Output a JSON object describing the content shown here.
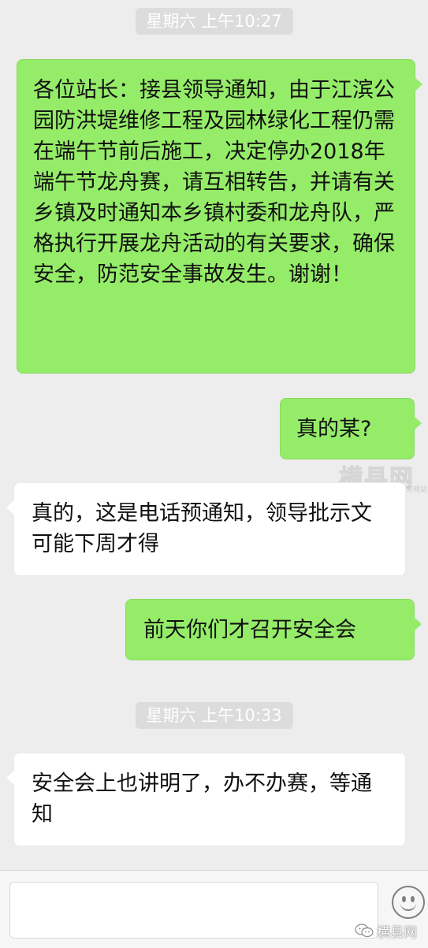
{
  "messages": [
    {
      "kind": "time",
      "text": "星期六 上午10:27"
    },
    {
      "kind": "sent",
      "text": "各位站长：接县领导通知，由于江滨公园防洪堤维修工程及园林绿化工程仍需在端午节前后施工，决定停办2018年端午节龙舟赛，请互相转告，并请有关乡镇及时通知本乡镇村委和龙舟队，严格执行开展龙舟活动的有关要求，确保安全，防范安全事故发生。谢谢！"
    },
    {
      "kind": "sent",
      "text": "真的某?"
    },
    {
      "kind": "received",
      "text": "真的，这是电话预通知，领导批示文可能下周才得"
    },
    {
      "kind": "sent",
      "text": "前天你们才召开安全会"
    },
    {
      "kind": "time",
      "text": "星期六 上午10:33"
    },
    {
      "kind": "received",
      "text": "安全会上也讲明了，办不办赛，等通知"
    }
  ],
  "watermark": {
    "title": "横县网",
    "subtitle": "横县生活资讯服务网站"
  },
  "footer": {
    "source_label": "横县网",
    "source_icon": "wechat-official-account-icon",
    "emoji_icon": "emoji-smile-icon"
  }
}
